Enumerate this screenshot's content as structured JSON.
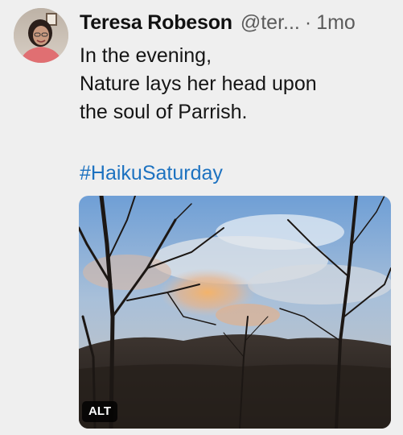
{
  "tweet": {
    "author_name": "Teresa Robeson",
    "handle": "@ter...",
    "separator": "·",
    "timestamp": "1mo",
    "lines": [
      "In the evening,",
      "Nature lays her head upon",
      "the soul of Parrish."
    ],
    "hashtag": "#HaikuSaturday",
    "media": {
      "alt_badge": "ALT"
    }
  },
  "colors": {
    "background": "#efefef",
    "link": "#1d72c0",
    "secondary_text": "#5b5b5b"
  }
}
